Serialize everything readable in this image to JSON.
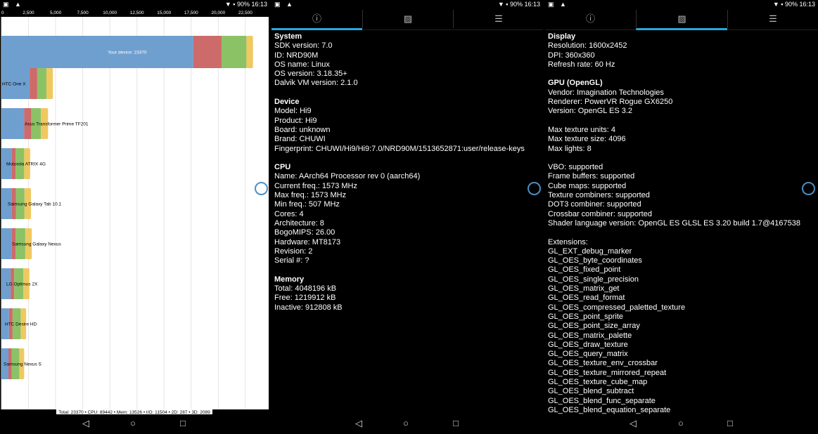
{
  "status": {
    "time": "16:13",
    "battery": "90%",
    "left_icons": "▣ ▲"
  },
  "nav_buttons": [
    "◁",
    "○",
    "□"
  ],
  "tabs": {
    "info": "ⓘ",
    "image": "▨",
    "list": "☰"
  },
  "chart_data": {
    "type": "bar",
    "orientation": "horizontal",
    "stacked": true,
    "xlim": [
      0,
      24000
    ],
    "ticks": [
      0,
      2500,
      5000,
      7500,
      10000,
      12500,
      15000,
      17500,
      20000,
      22500
    ],
    "tick_labels": [
      "0",
      "2,500",
      "5,000",
      "7,500",
      "10,000",
      "12,500",
      "15,000",
      "17,500",
      "20,000",
      "22,500"
    ],
    "categories": [
      "Your device: 23370",
      "HTC One X",
      "Asus Transformer Prime TF201",
      "Motorola ATRIX 4G",
      "Samsung Galaxy Tab 10.1",
      "Samsung Galaxy Nexus",
      "LG Optimus 2X",
      "HTC Desire HD",
      "Samsung Nexus S"
    ],
    "series": [
      {
        "color": "#6f9fcf",
        "values": [
          17700,
          2600,
          2100,
          950,
          950,
          950,
          850,
          700,
          650
        ]
      },
      {
        "color": "#cd6a6a",
        "values": [
          2600,
          700,
          650,
          350,
          380,
          350,
          330,
          330,
          300
        ]
      },
      {
        "color": "#8cc266",
        "values": [
          2300,
          850,
          900,
          800,
          800,
          900,
          850,
          750,
          700
        ]
      },
      {
        "color": "#f0c860",
        "values": [
          600,
          600,
          650,
          550,
          600,
          600,
          550,
          500,
          450
        ]
      }
    ],
    "total_label": "Total: 23370 • CPU: 89442 • Mem: 13526 • I/O: 11504 • 2D: 287 • 3D: 2089"
  },
  "system": {
    "title": "System",
    "lines": [
      "SDK version: 7.0",
      "ID: NRD90M",
      "OS name: Linux",
      "OS version: 3.18.35+",
      "Dalvik VM version: 2.1.0"
    ]
  },
  "device": {
    "title": "Device",
    "lines": [
      "Model: Hi9",
      "Product: Hi9",
      "Board: unknown",
      "Brand: CHUWI",
      "Fingerprint: CHUWI/Hi9/Hi9:7.0/NRD90M/1513652871:user/release-keys"
    ]
  },
  "cpu": {
    "title": "CPU",
    "lines": [
      "Name: AArch64 Processor rev 0 (aarch64)",
      "Current freq.: 1573 MHz",
      "Max freq.: 1573 MHz",
      "Min freq.: 507 MHz",
      "Cores: 4",
      "Architecture: 8",
      "BogoMIPS: 26.00",
      "Hardware: MT8173",
      "Revision: 2",
      "Serial #: ?"
    ]
  },
  "memory": {
    "title": "Memory",
    "lines": [
      "Total: 4048196 kB",
      "Free: 1219912 kB",
      "Inactive: 912808 kB"
    ]
  },
  "display": {
    "title": "Display",
    "lines": [
      "Resolution: 1600x2452",
      "DPI: 360x360",
      "Refresh rate: 60 Hz"
    ]
  },
  "gpu": {
    "title": "GPU (OpenGL)",
    "lines": [
      "Vendor: Imagination Technologies",
      "Renderer: PowerVR Rogue GX6250",
      "Version: OpenGL ES 3.2"
    ]
  },
  "gpu_limits": {
    "lines": [
      "Max texture units: 4",
      "Max texture size: 4096",
      "Max lights: 8"
    ]
  },
  "gpu_features": {
    "lines": [
      "VBO: supported",
      "Frame buffers: supported",
      "Cube maps: supported",
      "Texture combiners: supported",
      "DOT3 combiner: supported",
      "Crossbar combiner: supported",
      "Shader language version: OpenGL ES GLSL ES 3.20 build 1.7@4167538"
    ]
  },
  "extensions": {
    "title": "Extensions:",
    "lines": [
      "GL_EXT_debug_marker",
      "GL_OES_byte_coordinates",
      "GL_OES_fixed_point",
      "GL_OES_single_precision",
      "GL_OES_matrix_get",
      "GL_OES_read_format",
      "GL_OES_compressed_paletted_texture",
      "GL_OES_point_sprite",
      "GL_OES_point_size_array",
      "GL_OES_matrix_palette",
      "GL_OES_draw_texture",
      "GL_OES_query_matrix",
      "GL_OES_texture_env_crossbar",
      "GL_OES_texture_mirrored_repeat",
      "GL_OES_texture_cube_map",
      "GL_OES_blend_subtract",
      "GL_OES_blend_func_separate",
      "GL_OES_blend_equation_separate"
    ]
  }
}
